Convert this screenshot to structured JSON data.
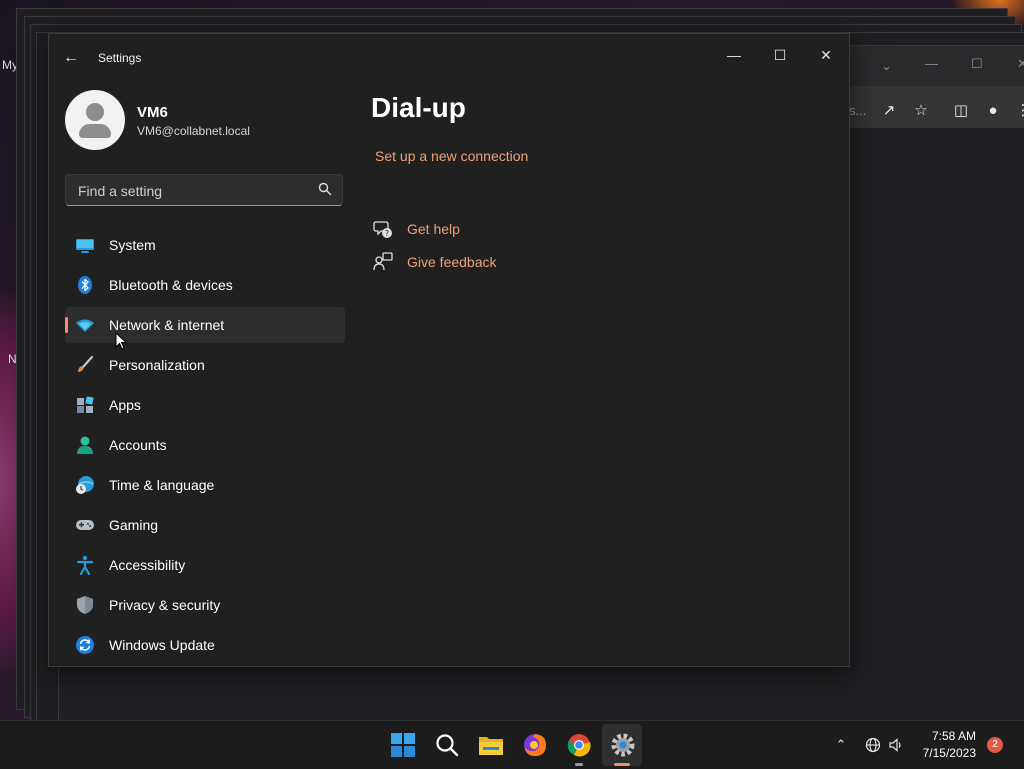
{
  "desktop": {
    "label_top": "My",
    "label_mid": "N"
  },
  "browser": {
    "omnibox_trailing_text": "s..."
  },
  "settings": {
    "app_title": "Settings",
    "user": {
      "name": "VM6",
      "email": "VM6@collabnet.local"
    },
    "search": {
      "placeholder": "Find a setting"
    },
    "nav": [
      {
        "label": "System",
        "icon": "system-icon",
        "selected": false
      },
      {
        "label": "Bluetooth & devices",
        "icon": "bluetooth-icon",
        "selected": false
      },
      {
        "label": "Network & internet",
        "icon": "network-wifi-icon",
        "selected": true
      },
      {
        "label": "Personalization",
        "icon": "paintbrush-icon",
        "selected": false
      },
      {
        "label": "Apps",
        "icon": "apps-icon",
        "selected": false
      },
      {
        "label": "Accounts",
        "icon": "person-icon",
        "selected": false
      },
      {
        "label": "Time & language",
        "icon": "globe-clock-icon",
        "selected": false
      },
      {
        "label": "Gaming",
        "icon": "gamepad-icon",
        "selected": false
      },
      {
        "label": "Accessibility",
        "icon": "accessibility-icon",
        "selected": false
      },
      {
        "label": "Privacy & security",
        "icon": "shield-icon",
        "selected": false
      },
      {
        "label": "Windows Update",
        "icon": "update-icon",
        "selected": false
      }
    ],
    "page": {
      "title": "Dial-up",
      "setup_link": "Set up a new connection",
      "get_help": "Get help",
      "give_feedback": "Give feedback"
    }
  },
  "taskbar": {
    "apps": [
      "start-icon",
      "search-icon",
      "file-explorer-icon",
      "firefox-icon",
      "chrome-icon",
      "settings-icon"
    ],
    "clock": {
      "time": "7:58 AM",
      "date": "7/15/2023"
    },
    "notification_count": "2"
  },
  "colors": {
    "accent_link": "#f0a078",
    "selection_bar": "#ff8a6a",
    "window_bg": "#202020",
    "taskbar_bg": "#1c1c1c"
  }
}
